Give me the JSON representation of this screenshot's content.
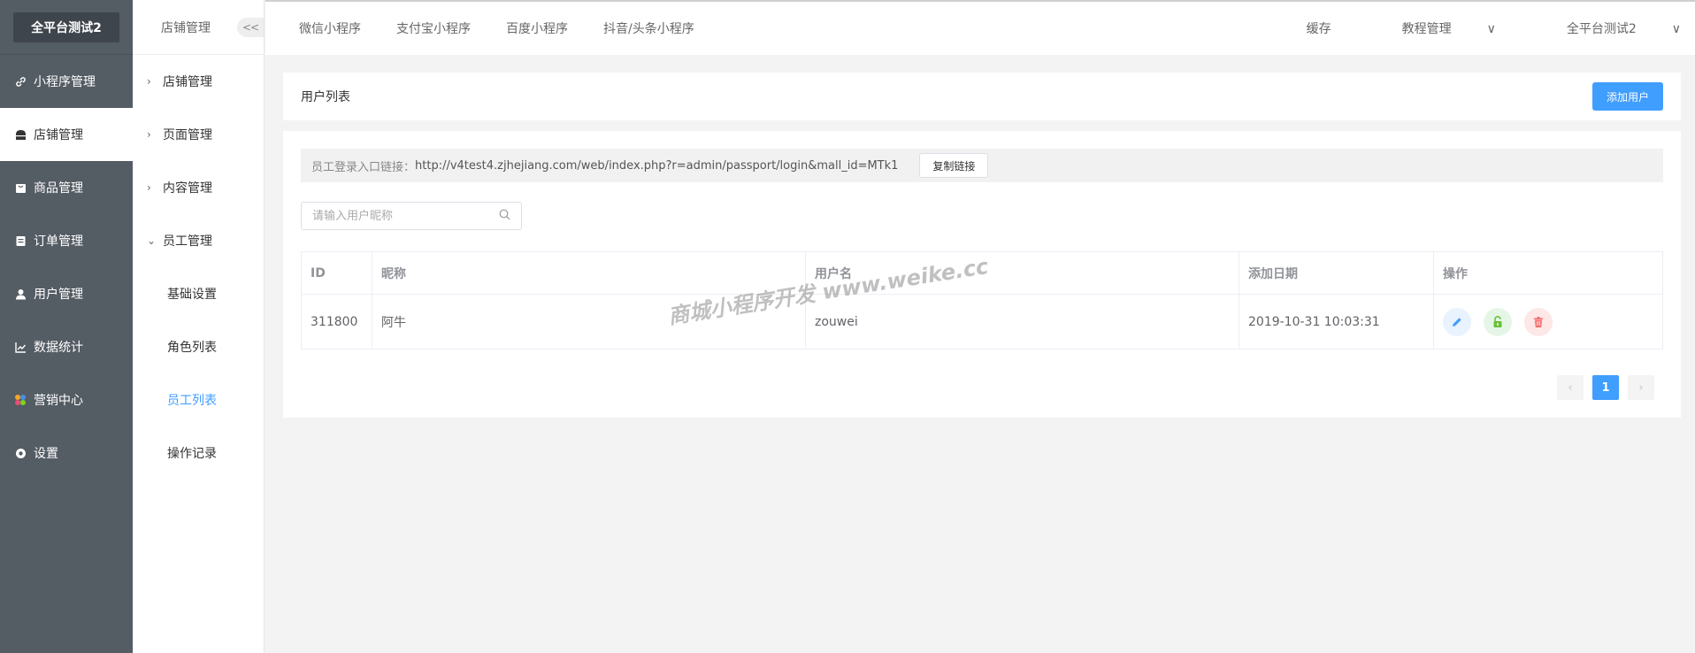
{
  "brand": "全平台测试2",
  "sidebar": {
    "items": [
      {
        "label": "小程序管理",
        "icon": "link-icon"
      },
      {
        "label": "店铺管理",
        "icon": "store-icon"
      },
      {
        "label": "商品管理",
        "icon": "goods-icon"
      },
      {
        "label": "订单管理",
        "icon": "order-icon"
      },
      {
        "label": "用户管理",
        "icon": "user-icon"
      },
      {
        "label": "数据统计",
        "icon": "chart-icon"
      },
      {
        "label": "营销中心",
        "icon": "marketing-icon"
      },
      {
        "label": "设置",
        "icon": "gear-icon"
      }
    ],
    "active_index": 1
  },
  "submenu": {
    "title": "店铺管理",
    "collapse_label": "<<",
    "items": [
      "店铺管理",
      "页面管理",
      "内容管理",
      "员工管理"
    ],
    "sub_items": [
      "基础设置",
      "角色列表",
      "员工列表",
      "操作记录"
    ],
    "active_sub": "员工列表"
  },
  "topbar": {
    "tabs": [
      "微信小程序",
      "支付宝小程序",
      "百度小程序",
      "抖音/头条小程序"
    ],
    "right": [
      "缓存",
      "教程管理",
      "全平台测试2"
    ]
  },
  "header": {
    "title": "用户列表",
    "add_button": "添加用户"
  },
  "link_bar": {
    "label": "员工登录入口链接：",
    "url": "http://v4test4.zjhejiang.com/web/index.php?r=admin/passport/login&mall_id=MTk1",
    "copy_button": "复制链接"
  },
  "search": {
    "placeholder": "请输入用户昵称",
    "value": ""
  },
  "table": {
    "columns": [
      "ID",
      "昵称",
      "用户名",
      "添加日期",
      "操作"
    ],
    "rows": [
      {
        "id": "311800",
        "nickname": "阿牛",
        "username": "zouwei",
        "date": "2019-10-31 10:03:31"
      }
    ]
  },
  "pagination": {
    "prev": "‹",
    "current": "1",
    "next": "›"
  },
  "watermark": "商城小程序开发 www.weike.cc",
  "colors": {
    "primary": "#409eff",
    "sidebar_bg": "#545c64",
    "edit": "#409eff",
    "lock": "#67c23a",
    "delete": "#f56c6c"
  }
}
